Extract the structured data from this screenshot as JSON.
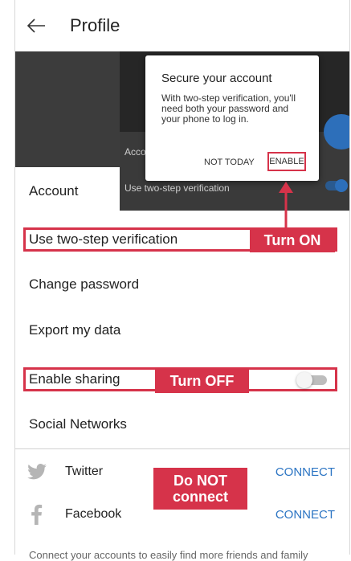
{
  "header": {
    "title": "Profile"
  },
  "preview": {
    "account_label": "Acco",
    "two_step_label": "Use two-step verification"
  },
  "dialog": {
    "title": "Secure your account",
    "body": "With two-step verification, you'll need both your password and your phone to log in.",
    "not_today": "NOT TODAY",
    "enable": "ENABLE"
  },
  "section": {
    "account": "Account"
  },
  "settings": {
    "two_step": "Use two-step verification",
    "change_password": "Change password",
    "export": "Export my data",
    "sharing": "Enable sharing",
    "sharing_enabled": false,
    "social_networks": "Social Networks"
  },
  "social": [
    {
      "name": "Twitter",
      "action": "CONNECT",
      "icon": "twitter-icon"
    },
    {
      "name": "Facebook",
      "action": "CONNECT",
      "icon": "facebook-icon"
    }
  ],
  "annotations": {
    "turn_on": "Turn ON",
    "turn_off": "Turn OFF",
    "do_not_connect": "Do NOT connect"
  },
  "footer": {
    "text": "Connect your accounts to easily find more friends and family"
  },
  "colors": {
    "annotation_red": "#d6334a",
    "link_blue": "#2b74c3",
    "toggle_off": "#bdbdbd"
  }
}
